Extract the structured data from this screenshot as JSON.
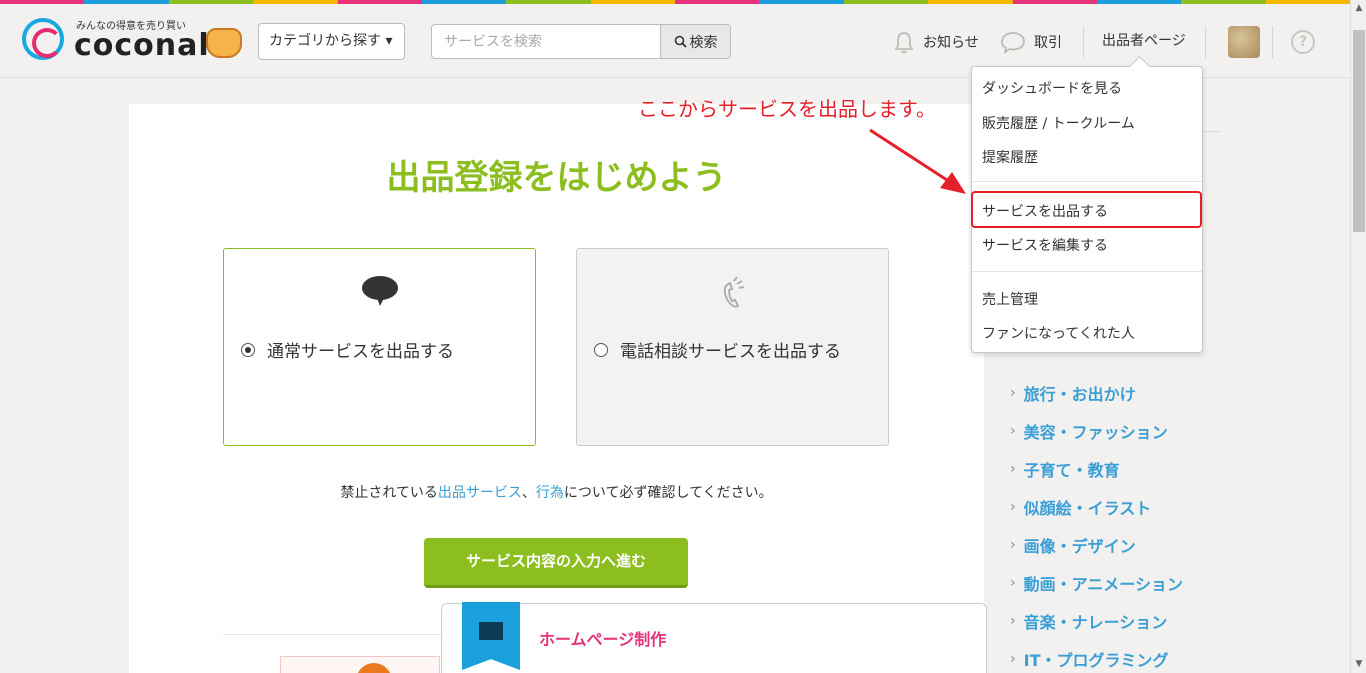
{
  "header": {
    "logo_tagline": "みんなの得意を売り買い",
    "logo_word": "coconala",
    "category_label": "カテゴリから探す ▾",
    "search_placeholder": "サービスを検索",
    "search_button": "検索",
    "notifications": "お知らせ",
    "transactions": "取引",
    "seller_page": "出品者ページ",
    "help": "?"
  },
  "stripe_colors": [
    "#e8337a",
    "#1aa0dc",
    "#8cbe1f",
    "#f5b800",
    "#e8337a",
    "#1aa0dc",
    "#8cbe1f",
    "#f5b800",
    "#e8337a",
    "#1aa0dc",
    "#8cbe1f",
    "#f5b800",
    "#e8337a",
    "#1aa0dc",
    "#8cbe1f",
    "#f5b800"
  ],
  "main": {
    "title": "出品登録をはじめよう",
    "options": [
      {
        "label": "通常サービスを出品する",
        "icon": "speech-bubble-icon",
        "selected": true
      },
      {
        "label": "電話相談サービスを出品する",
        "icon": "phone-icon",
        "selected": false
      }
    ],
    "note_prefix": "禁止されている",
    "note_link1": "出品サービス",
    "note_sep": "、",
    "note_link2": "行為",
    "note_suffix": "について必ず確認してください。",
    "next_button": "サービス内容の入力へ進む"
  },
  "service_card": {
    "title": "ホームページ制作",
    "icon": "monitor-icon"
  },
  "dropdown": {
    "items": [
      "ダッシュボードを見る",
      "販売履歴 / トークルーム",
      "提案履歴",
      "サービスを出品する",
      "サービスを編集する",
      "売上管理",
      "ファンになってくれた人"
    ]
  },
  "annotation": {
    "text": "ここからサービスを出品します。",
    "color": "#e5202a"
  },
  "sidebar": {
    "categories": [
      "旅行・お出かけ",
      "美容・ファッション",
      "子育て・教育",
      "似顔絵・イラスト",
      "画像・デザイン",
      "動画・アニメーション",
      "音楽・ナレーション",
      "IT・プログラミング"
    ]
  },
  "colors": {
    "brand_green": "#8cbe1f",
    "link_blue": "#3a9fd6",
    "accent_pink": "#e8337a"
  }
}
